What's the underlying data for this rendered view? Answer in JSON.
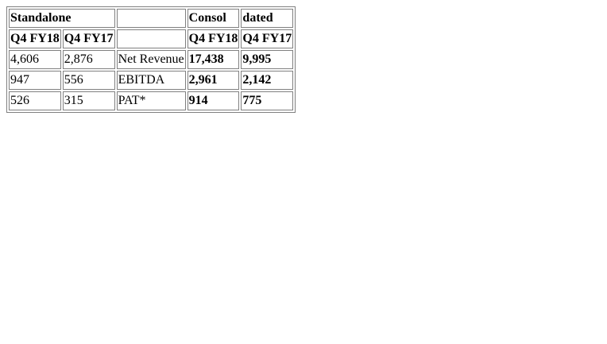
{
  "table": {
    "header_row_1": [
      "Standalone",
      "",
      "",
      "Consol",
      "dated"
    ],
    "header_row_2": [
      "Q4 FY18",
      "Q4 FY17",
      "",
      "Q4 FY18",
      "Q4 FY17"
    ],
    "rows": [
      {
        "s18": "4,606",
        "s17": "2,876",
        "label": "Net Revenue",
        "c18": "17,438",
        "c17": "9,995"
      },
      {
        "s18": "947",
        "s17": "556",
        "label": "EBITDA",
        "c18": "2,961",
        "c17": "2,142"
      },
      {
        "s18": "526",
        "s17": "315",
        "label": "PAT*",
        "c18": "914",
        "c17": "775"
      }
    ]
  }
}
